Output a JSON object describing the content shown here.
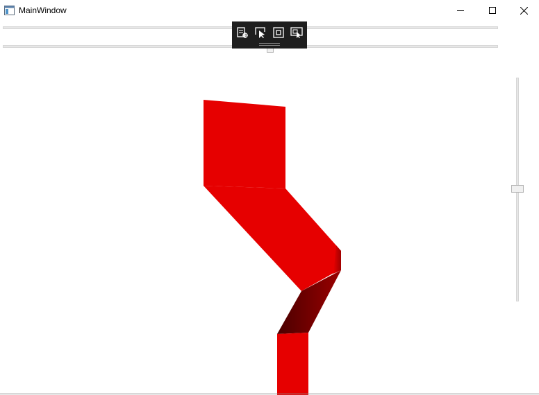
{
  "window": {
    "title": "MainWindow",
    "buttons": {
      "minimize": "minimize",
      "maximize": "maximize",
      "close": "close"
    }
  },
  "debug_toolbar": {
    "icons": [
      "live-visual-tree-icon",
      "select-element-icon",
      "display-layout-adorners-icon",
      "track-focused-element-icon"
    ]
  },
  "scene": {
    "shape_color": "#e60000",
    "shadow_color": "#5a0000"
  }
}
